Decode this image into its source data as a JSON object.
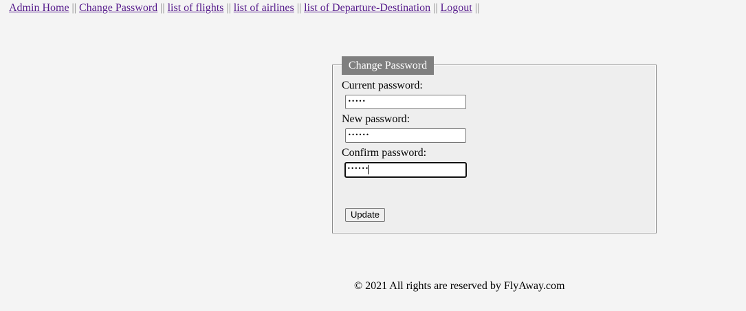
{
  "nav": {
    "items": [
      {
        "label": "Admin Home"
      },
      {
        "label": "Change Password"
      },
      {
        "label": "list of flights"
      },
      {
        "label": "list of airlines"
      },
      {
        "label": "list of Departure-Destination"
      },
      {
        "label": "Logout"
      }
    ],
    "separator": "||"
  },
  "form": {
    "legend": "Change Password",
    "current_label": "Current password:",
    "current_value": "•••••",
    "new_label": "New password:",
    "new_value": "••••••",
    "confirm_label": "Confirm password:",
    "confirm_value": "••••••",
    "submit_label": "Update"
  },
  "footer": {
    "text": "© 2021 All rights are reserved by FlyAway.com"
  },
  "colors": {
    "background": "#f4f4f4",
    "link": "#551a8b",
    "legend_bg": "#7f7f7f",
    "fieldset_bg": "#eeeeee"
  }
}
